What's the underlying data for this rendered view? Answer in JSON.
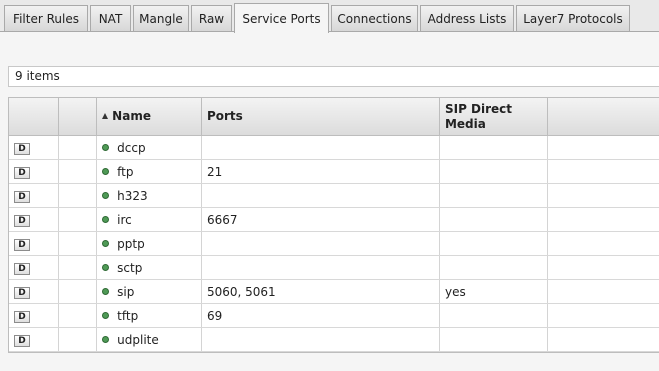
{
  "tabs": [
    {
      "label": "Filter Rules",
      "active": false
    },
    {
      "label": "NAT",
      "active": false
    },
    {
      "label": "Mangle",
      "active": false
    },
    {
      "label": "Raw",
      "active": false
    },
    {
      "label": "Service Ports",
      "active": true
    },
    {
      "label": "Connections",
      "active": false
    },
    {
      "label": "Address Lists",
      "active": false
    },
    {
      "label": "Layer7 Protocols",
      "active": false
    }
  ],
  "item_count": "9 items",
  "columns": {
    "name": "Name",
    "ports": "Ports",
    "sip_direct_media": "SIP Direct Media"
  },
  "sort_icon": "sort-ascending-icon",
  "status_icon": "enabled-status-dot-icon",
  "status_color": "#4f9a56",
  "rows": [
    {
      "flag": "D",
      "name": "dccp",
      "ports": "",
      "sip": ""
    },
    {
      "flag": "D",
      "name": "ftp",
      "ports": "21",
      "sip": ""
    },
    {
      "flag": "D",
      "name": "h323",
      "ports": "",
      "sip": ""
    },
    {
      "flag": "D",
      "name": "irc",
      "ports": "6667",
      "sip": ""
    },
    {
      "flag": "D",
      "name": "pptp",
      "ports": "",
      "sip": ""
    },
    {
      "flag": "D",
      "name": "sctp",
      "ports": "",
      "sip": ""
    },
    {
      "flag": "D",
      "name": "sip",
      "ports": "5060, 5061",
      "sip": "yes"
    },
    {
      "flag": "D",
      "name": "tftp",
      "ports": "69",
      "sip": ""
    },
    {
      "flag": "D",
      "name": "udplite",
      "ports": "",
      "sip": ""
    }
  ]
}
